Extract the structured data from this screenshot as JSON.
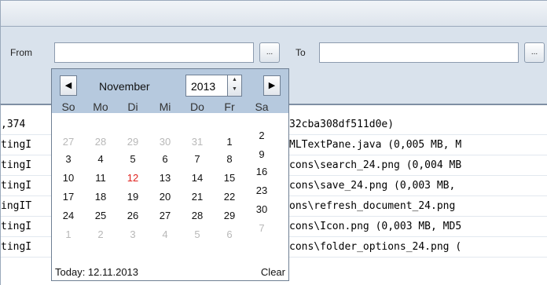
{
  "filter": {
    "from_label": "From",
    "to_label": "To",
    "from_value": "",
    "to_value": "",
    "browse_label": "..."
  },
  "content_rows": [
    {
      "left": ",374",
      "right": "32cba308df511d0e)"
    },
    {
      "left": "tingI",
      "right": "MLTextPane.java (0,005 MB, M"
    },
    {
      "left": "tingI",
      "right": "cons\\search_24.png (0,004 MB"
    },
    {
      "left": "tingI",
      "right": "cons\\save_24.png (0,003 MB,"
    },
    {
      "left": "ingIT",
      "right": "ons\\refresh_document_24.png"
    },
    {
      "left": "tingI",
      "right": "cons\\Icon.png (0,003 MB, MD5"
    },
    {
      "left": "tingI",
      "right": "cons\\folder_options_24.png ("
    }
  ],
  "calendar": {
    "prev_icon": "◀",
    "next_icon": "▶",
    "month": "November",
    "year": "2013",
    "weekdays": [
      "So",
      "Mo",
      "Di",
      "Mi",
      "Do",
      "Fr",
      "Sa"
    ],
    "weeks": [
      [
        {
          "d": "27",
          "o": true
        },
        {
          "d": "28",
          "o": true
        },
        {
          "d": "29",
          "o": true
        },
        {
          "d": "30",
          "o": true
        },
        {
          "d": "31",
          "o": true
        },
        {
          "d": "1"
        },
        {
          "d": "2"
        }
      ],
      [
        {
          "d": "3"
        },
        {
          "d": "4"
        },
        {
          "d": "5"
        },
        {
          "d": "6"
        },
        {
          "d": "7"
        },
        {
          "d": "8"
        },
        {
          "d": "9"
        }
      ],
      [
        {
          "d": "10"
        },
        {
          "d": "11"
        },
        {
          "d": "12",
          "t": true
        },
        {
          "d": "13"
        },
        {
          "d": "14"
        },
        {
          "d": "15"
        },
        {
          "d": "16"
        }
      ],
      [
        {
          "d": "17"
        },
        {
          "d": "18"
        },
        {
          "d": "19"
        },
        {
          "d": "20"
        },
        {
          "d": "21"
        },
        {
          "d": "22"
        },
        {
          "d": "23"
        }
      ],
      [
        {
          "d": "24"
        },
        {
          "d": "25"
        },
        {
          "d": "26"
        },
        {
          "d": "27"
        },
        {
          "d": "28"
        },
        {
          "d": "29"
        },
        {
          "d": "30"
        }
      ],
      [
        {
          "d": "1",
          "o": true
        },
        {
          "d": "2",
          "o": true
        },
        {
          "d": "3",
          "o": true
        },
        {
          "d": "4",
          "o": true
        },
        {
          "d": "5",
          "o": true
        },
        {
          "d": "6",
          "o": true
        },
        {
          "d": "7",
          "o": true
        }
      ]
    ],
    "today_label": "Today: 12.11.2013",
    "clear_label": "Clear",
    "today_color": "#e0221e",
    "header_color": "#b6c9de"
  }
}
